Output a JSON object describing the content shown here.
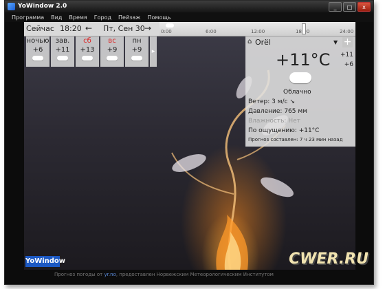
{
  "window": {
    "title": "YoWindow 2.0",
    "buttons": [
      "_",
      "□",
      "x"
    ]
  },
  "menu": [
    "Программа",
    "Вид",
    "Время",
    "Город",
    "Пейзаж",
    "Помощь"
  ],
  "timebar": {
    "now_label": "Сейчас",
    "time": "18:20",
    "prev": "←",
    "date": "Пт, Сен 30",
    "next": "→",
    "timeline_labels": [
      "0:00",
      "6:00",
      "12:00",
      "18:00",
      "24:00"
    ]
  },
  "forecast": [
    {
      "name": "ночью",
      "temp": "+6",
      "icon": "cloud-icon",
      "weekend": false
    },
    {
      "name": "зав.",
      "temp": "+11",
      "icon": "cloud-icon",
      "weekend": false
    },
    {
      "name": "сб",
      "temp": "+13",
      "icon": "rain-cloud-icon",
      "weekend": true
    },
    {
      "name": "вс",
      "temp": "+9",
      "icon": "rain-cloud-icon",
      "weekend": true
    },
    {
      "name": "пн",
      "temp": "+9",
      "icon": "cloud-icon",
      "weekend": false
    }
  ],
  "forecast_more": "▸",
  "current": {
    "city": "Orël",
    "temp": "+11°C",
    "hi": "+11",
    "lo": "+6",
    "condition": "Облачно",
    "rows": [
      {
        "label": "Ветер:",
        "value": "3 м/с ↘"
      },
      {
        "label": "Давление:",
        "value": "765 мм"
      },
      {
        "label": "Влажность:",
        "value": "Нет"
      },
      {
        "label": "По ощущению:",
        "value": "+11°C"
      }
    ],
    "issued": "Прогноз составлен:   7 ч 23 мин назад"
  },
  "logo": "YoWindow",
  "status": {
    "prefix": "Прогноз погоды от",
    "link": "yr.no",
    "suffix": ", предоставлен Норвежским Метеорологическим Институтом"
  },
  "watermark": "CWER.RU",
  "colors": {
    "weekend": "#dd2222",
    "link": "#5b8ad8",
    "logo_bg": "#1c59c4"
  }
}
